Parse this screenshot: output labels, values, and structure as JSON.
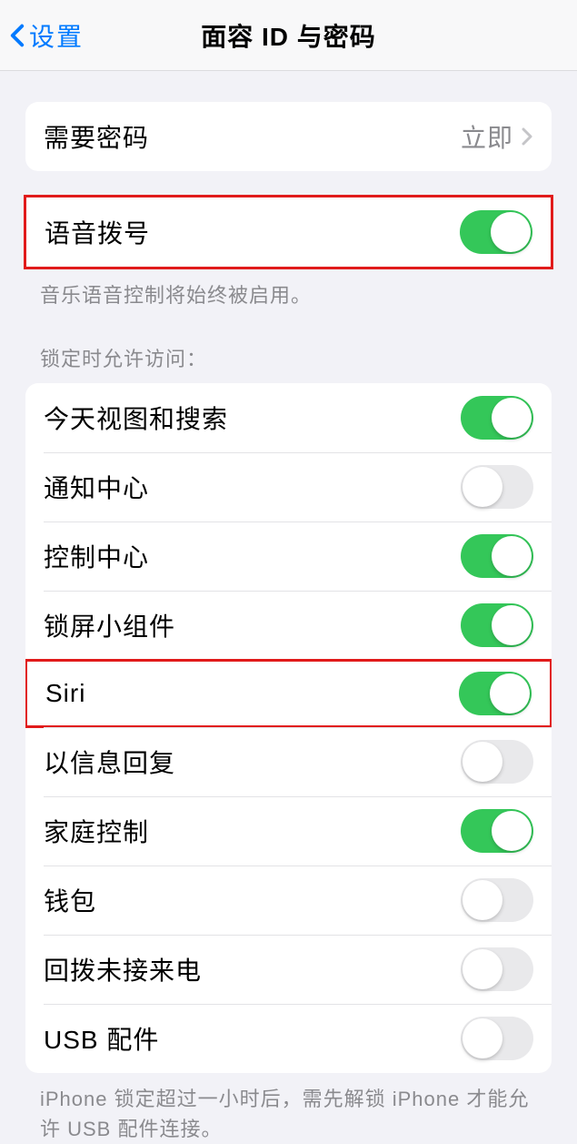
{
  "nav": {
    "back_label": "设置",
    "title": "面容 ID 与密码"
  },
  "require_passcode": {
    "label": "需要密码",
    "value": "立即"
  },
  "voice_dial": {
    "label": "语音拨号",
    "on": true,
    "footer": "音乐语音控制将始终被启用。"
  },
  "lock_access": {
    "header": "锁定时允许访问：",
    "items": [
      {
        "label": "今天视图和搜索",
        "on": true
      },
      {
        "label": "通知中心",
        "on": false
      },
      {
        "label": "控制中心",
        "on": true
      },
      {
        "label": "锁屏小组件",
        "on": true
      },
      {
        "label": "Siri",
        "on": true,
        "highlighted": true
      },
      {
        "label": "以信息回复",
        "on": false
      },
      {
        "label": "家庭控制",
        "on": true
      },
      {
        "label": "钱包",
        "on": false
      },
      {
        "label": "回拨未接来电",
        "on": false
      },
      {
        "label": "USB 配件",
        "on": false
      }
    ],
    "footer": "iPhone 锁定超过一小时后，需先解锁 iPhone 才能允许 USB 配件连接。"
  }
}
